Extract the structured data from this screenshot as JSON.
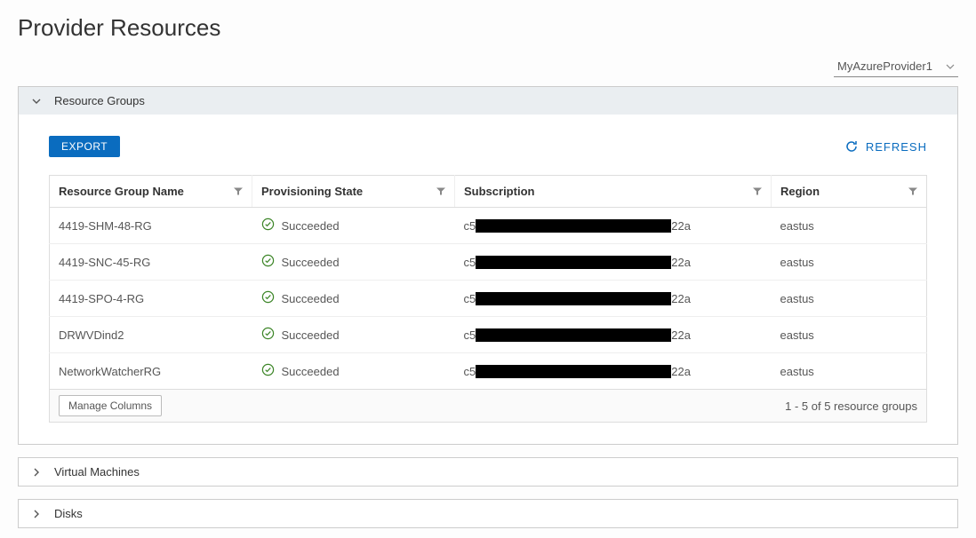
{
  "page_title": "Provider Resources",
  "provider_selector": {
    "selected": "MyAzureProvider1"
  },
  "sections": {
    "resource_groups": {
      "title": "Resource Groups",
      "expanded": true,
      "toolbar": {
        "export_label": "EXPORT",
        "refresh_label": "REFRESH"
      },
      "columns": {
        "name": "Resource Group Name",
        "state": "Provisioning State",
        "subscription": "Subscription",
        "region": "Region"
      },
      "rows": [
        {
          "name": "4419-SHM-48-RG",
          "state": "Succeeded",
          "sub_prefix": "c5",
          "sub_suffix": "22a",
          "region": "eastus"
        },
        {
          "name": "4419-SNC-45-RG",
          "state": "Succeeded",
          "sub_prefix": "c5",
          "sub_suffix": "22a",
          "region": "eastus"
        },
        {
          "name": "4419-SPO-4-RG",
          "state": "Succeeded",
          "sub_prefix": "c5",
          "sub_suffix": "22a",
          "region": "eastus"
        },
        {
          "name": "DRWVDind2",
          "state": "Succeeded",
          "sub_prefix": "c5",
          "sub_suffix": "22a",
          "region": "eastus"
        },
        {
          "name": "NetworkWatcherRG",
          "state": "Succeeded",
          "sub_prefix": "c5",
          "sub_suffix": "22a",
          "region": "eastus"
        }
      ],
      "footer": {
        "manage_columns_label": "Manage Columns",
        "count_text": "1 - 5 of 5 resource groups"
      }
    },
    "virtual_machines": {
      "title": "Virtual Machines",
      "expanded": false
    },
    "disks": {
      "title": "Disks",
      "expanded": false
    }
  }
}
